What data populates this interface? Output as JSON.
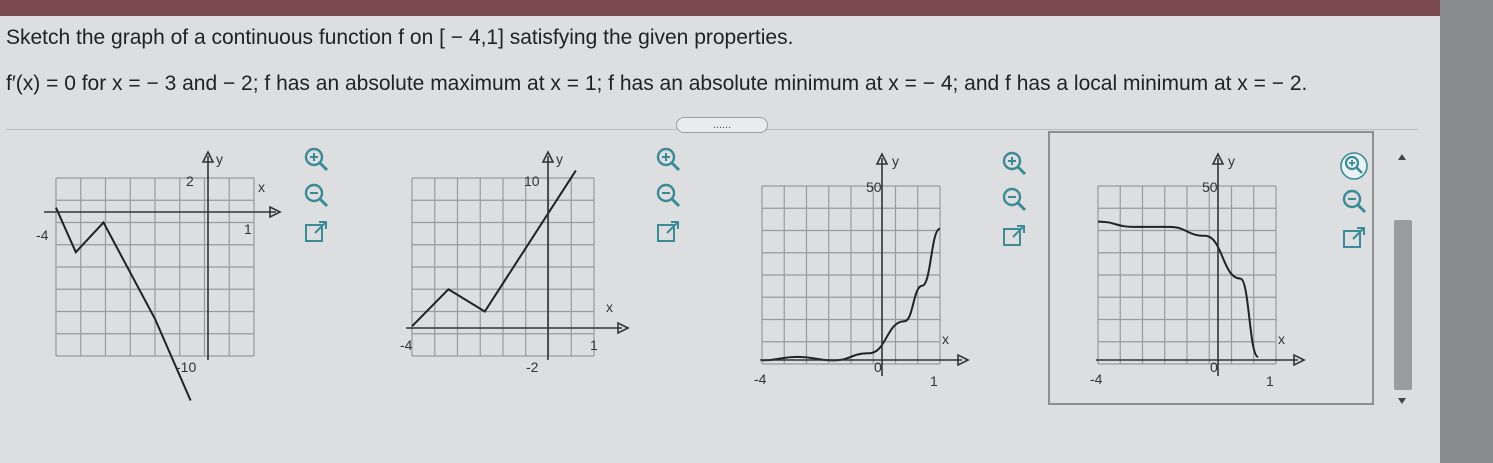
{
  "question": {
    "line1": "Sketch the graph of a continuous function f on [ − 4,1] satisfying the given properties.",
    "line2": "f′(x) = 0 for x = − 3 and − 2; f has an absolute maximum at x = 1; f has an absolute minimum at x = − 4; and f has a local minimum at x = − 2."
  },
  "more_button": "......",
  "options": [
    {
      "id": "A",
      "x_label": "x",
      "y_label": "y",
      "xmin_label": "-4",
      "xmax_label": "1",
      "ymax_label": "2",
      "ymin_label": "-10",
      "selected": false,
      "zoom_in_icon": "zoom-in-icon",
      "zoom_out_icon": "zoom-out-icon",
      "popout_icon": "external-link-icon"
    },
    {
      "id": "B",
      "x_label": "x",
      "y_label": "y",
      "xmin_label": "-4",
      "xmax_label": "1",
      "ymax_label": "10",
      "ymin_label": "-2",
      "selected": false,
      "zoom_in_icon": "zoom-in-icon",
      "zoom_out_icon": "zoom-out-icon",
      "popout_icon": "external-link-icon"
    },
    {
      "id": "C",
      "x_label": "x",
      "y_label": "y",
      "xmin_label": "-4",
      "xmax_label": "1",
      "ymax_label": "50",
      "ymin_label": "0",
      "selected": false,
      "zoom_in_icon": "zoom-in-icon",
      "zoom_out_icon": "zoom-out-icon",
      "popout_icon": "external-link-icon"
    },
    {
      "id": "D",
      "x_label": "x",
      "y_label": "y",
      "xmin_label": "-4",
      "xmax_label": "1",
      "ymax_label": "50",
      "ymin_label": "0",
      "selected": true,
      "zoom_in_icon": "zoom-in-icon",
      "zoom_out_icon": "zoom-out-icon",
      "popout_icon": "external-link-icon"
    }
  ],
  "chart_data": [
    {
      "type": "line",
      "title": "",
      "xlabel": "x",
      "ylabel": "y",
      "xlim": [
        -4,
        1
      ],
      "ylim": [
        -10,
        2
      ],
      "series": [
        {
          "x": [
            -4,
            -3.5,
            -2.8,
            -1.5,
            -0.6
          ],
          "y": [
            0,
            -3,
            -1,
            -7.5,
            -13
          ]
        }
      ]
    },
    {
      "type": "line",
      "title": "",
      "xlabel": "x",
      "ylabel": "y",
      "xlim": [
        -4,
        1
      ],
      "ylim": [
        -2,
        10
      ],
      "series": [
        {
          "x": [
            -4,
            -3,
            -2,
            0.5
          ],
          "y": [
            0,
            2.5,
            1,
            10.5
          ]
        }
      ]
    },
    {
      "type": "line",
      "title": "",
      "xlabel": "x",
      "ylabel": "y",
      "xlim": [
        -4,
        1
      ],
      "ylim": [
        0,
        50
      ],
      "series": [
        {
          "x": [
            -4,
            -3,
            -2,
            -1,
            0,
            0.5,
            1
          ],
          "y": [
            1,
            2,
            1,
            3,
            12,
            22,
            38
          ]
        }
      ]
    },
    {
      "type": "line",
      "title": "",
      "xlabel": "x",
      "ylabel": "y",
      "xlim": [
        -4,
        1
      ],
      "ylim": [
        0,
        50
      ],
      "series": [
        {
          "x": [
            -4,
            -3,
            -2,
            -1,
            0,
            0.5
          ],
          "y": [
            40,
            38.5,
            38.5,
            36,
            24,
            2
          ]
        }
      ]
    }
  ]
}
